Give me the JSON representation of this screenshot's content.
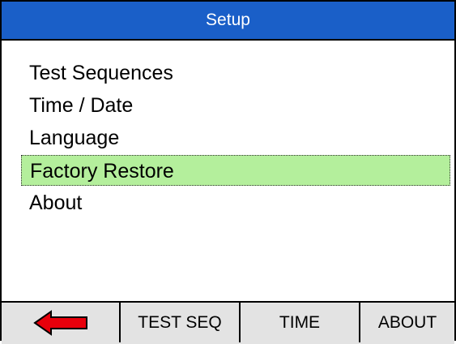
{
  "header": {
    "title": "Setup"
  },
  "menu": {
    "items": [
      {
        "label": "Test Sequences",
        "selected": false
      },
      {
        "label": "Time / Date",
        "selected": false
      },
      {
        "label": "Language",
        "selected": false
      },
      {
        "label": "Factory Restore",
        "selected": true
      },
      {
        "label": "About",
        "selected": false
      }
    ]
  },
  "softkeys": {
    "back_icon": "left-arrow-icon",
    "test_seq_label": "TEST SEQ",
    "time_label": "TIME",
    "about_label": "ABOUT"
  },
  "colors": {
    "title_bar": "#1a5fc8",
    "selected_item": "#b4ef9c",
    "softkey_bar": "#e3e3e3",
    "back_arrow": "#e8000b"
  }
}
